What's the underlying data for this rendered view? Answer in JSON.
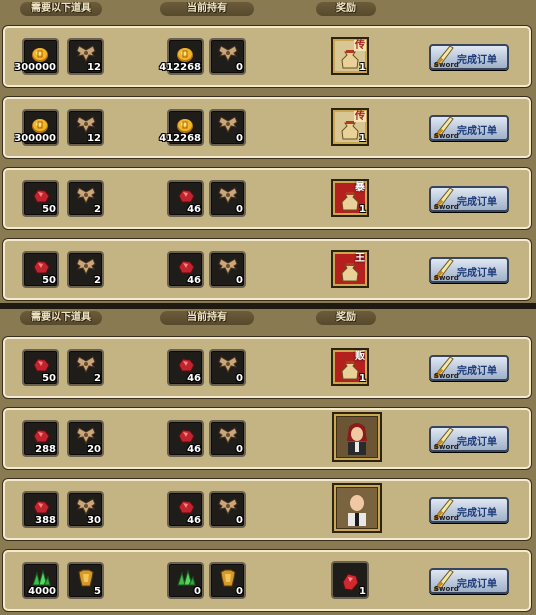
{
  "headers": {
    "need": "需要以下道具",
    "current": "当前持有",
    "reward": "奖励"
  },
  "button_label": "完成订单",
  "button_icon_label": "Sword",
  "panels": [
    {
      "rows": [
        {
          "need1": {
            "icon": "gold-coin-icon",
            "count": "300000"
          },
          "need2": {
            "icon": "bat-wing-icon",
            "count": "12"
          },
          "have1": {
            "icon": "gold-coin-icon",
            "count": "412268"
          },
          "have2": {
            "icon": "bat-wing-icon",
            "count": "0"
          },
          "reward": {
            "icon": "sack-icon",
            "tag": "传",
            "count": "1"
          }
        },
        {
          "need1": {
            "icon": "gold-coin-icon",
            "count": "300000"
          },
          "need2": {
            "icon": "bat-wing-icon",
            "count": "12"
          },
          "have1": {
            "icon": "gold-coin-icon",
            "count": "412268"
          },
          "have2": {
            "icon": "bat-wing-icon",
            "count": "0"
          },
          "reward": {
            "icon": "sack-icon",
            "tag": "传",
            "count": "1"
          }
        },
        {
          "need1": {
            "icon": "red-ore-icon",
            "count": "50"
          },
          "need2": {
            "icon": "bat-wing-icon",
            "count": "2"
          },
          "have1": {
            "icon": "red-ore-icon",
            "count": "46"
          },
          "have2": {
            "icon": "bat-wing-icon",
            "count": "0"
          },
          "reward": {
            "icon": "sack-icon",
            "tag": "暴",
            "count": "1"
          }
        },
        {
          "need1": {
            "icon": "red-ore-icon",
            "count": "50"
          },
          "need2": {
            "icon": "bat-wing-icon",
            "count": "2"
          },
          "have1": {
            "icon": "red-ore-icon",
            "count": "46"
          },
          "have2": {
            "icon": "bat-wing-icon",
            "count": "0"
          },
          "reward": {
            "icon": "sack-icon",
            "tag": "王",
            "count": ""
          }
        }
      ]
    },
    {
      "rows": [
        {
          "need1": {
            "icon": "red-ore-icon",
            "count": "50"
          },
          "need2": {
            "icon": "bat-wing-icon",
            "count": "2"
          },
          "have1": {
            "icon": "red-ore-icon",
            "count": "46"
          },
          "have2": {
            "icon": "bat-wing-icon",
            "count": "0"
          },
          "reward": {
            "icon": "sack-icon",
            "tag": "贩",
            "count": "1"
          }
        },
        {
          "need1": {
            "icon": "red-ore-icon",
            "count": "288"
          },
          "need2": {
            "icon": "bat-wing-icon",
            "count": "20"
          },
          "have1": {
            "icon": "red-ore-icon",
            "count": "46"
          },
          "have2": {
            "icon": "bat-wing-icon",
            "count": "0"
          },
          "reward": {
            "icon": "character-portrait-red-hair-icon",
            "tag": "",
            "count": ""
          }
        },
        {
          "need1": {
            "icon": "red-ore-icon",
            "count": "388"
          },
          "need2": {
            "icon": "bat-wing-icon",
            "count": "30"
          },
          "have1": {
            "icon": "red-ore-icon",
            "count": "46"
          },
          "have2": {
            "icon": "bat-wing-icon",
            "count": "0"
          },
          "reward": {
            "icon": "character-portrait-bald-icon",
            "tag": "",
            "count": ""
          }
        },
        {
          "need1": {
            "icon": "green-crystal-icon",
            "count": "4000"
          },
          "need2": {
            "icon": "gold-armor-icon",
            "count": "5"
          },
          "have1": {
            "icon": "green-crystal-icon",
            "count": "0"
          },
          "have2": {
            "icon": "gold-armor-icon",
            "count": "0"
          },
          "reward": {
            "icon": "red-gem-icon",
            "tag": "",
            "count": "1"
          }
        }
      ]
    }
  ]
}
